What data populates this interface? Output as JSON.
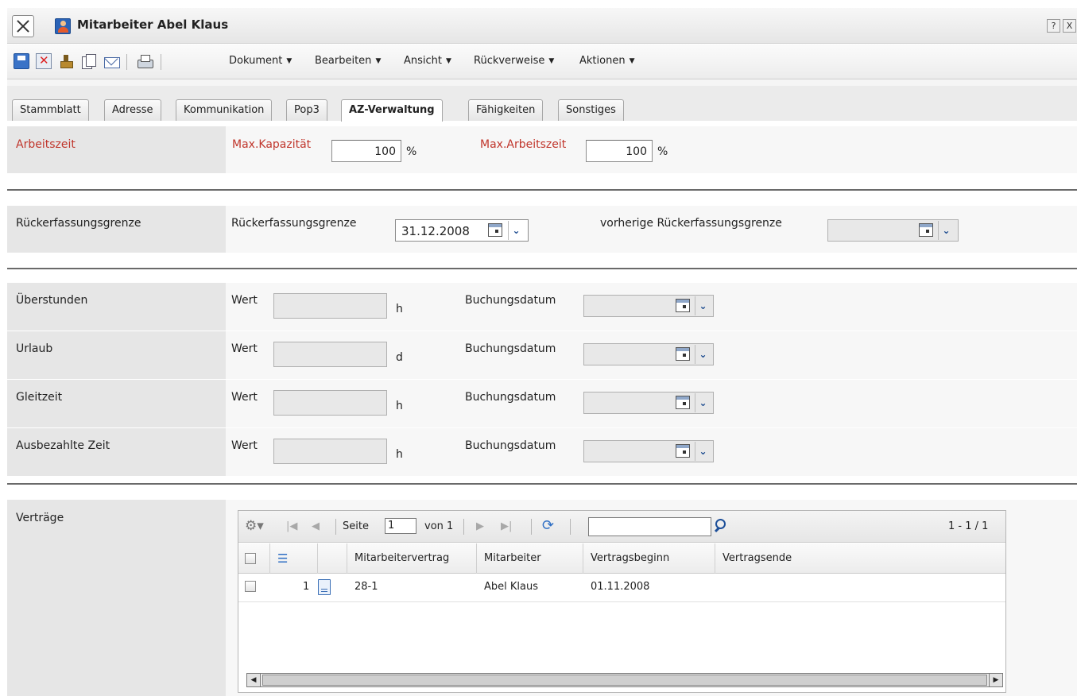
{
  "window": {
    "title": "Mitarbeiter Abel Klaus",
    "help_label": "?",
    "close_label": "X"
  },
  "toolbar": {
    "icons": [
      "save-icon",
      "delete-icon",
      "stamp-icon",
      "copy-icon",
      "mail-icon",
      "print-icon"
    ],
    "menus": [
      {
        "label": "Dokument"
      },
      {
        "label": "Bearbeiten"
      },
      {
        "label": "Ansicht"
      },
      {
        "label": "Rückverweise"
      },
      {
        "label": "Aktionen"
      }
    ],
    "menu_arrow": "▼"
  },
  "tabs": [
    {
      "label": "Stammblatt"
    },
    {
      "label": "Adresse"
    },
    {
      "label": "Kommunikation"
    },
    {
      "label": "Pop3"
    },
    {
      "label": "AZ-Verwaltung",
      "active": true
    },
    {
      "label": "Fähigkeiten"
    },
    {
      "label": "Sonstiges"
    }
  ],
  "form": {
    "arbeitszeit": {
      "section_label": "Arbeitszeit",
      "max_kapazitaet_label": "Max.Kapazität",
      "max_kapazitaet_value": "100",
      "max_kapazitaet_unit": "%",
      "max_arbeitszeit_label": "Max.Arbeitszeit",
      "max_arbeitszeit_value": "100",
      "max_arbeitszeit_unit": "%",
      "label_color": "#c0352b"
    },
    "rueckerfassung": {
      "section_label": "Rückerfassungsgrenze",
      "field_label": "Rückerfassungsgrenze",
      "field_value": "31.12.2008",
      "prev_label": "vorherige Rückerfassungsgrenze",
      "prev_value": ""
    },
    "bookings": [
      {
        "section_label": "Überstunden",
        "wert_label": "Wert",
        "wert_value": "",
        "unit": "h",
        "datum_label": "Buchungsdatum",
        "datum_value": ""
      },
      {
        "section_label": "Urlaub",
        "wert_label": "Wert",
        "wert_value": "",
        "unit": "d",
        "datum_label": "Buchungsdatum",
        "datum_value": ""
      },
      {
        "section_label": "Gleitzeit",
        "wert_label": "Wert",
        "wert_value": "",
        "unit": "h",
        "datum_label": "Buchungsdatum",
        "datum_value": ""
      },
      {
        "section_label": "Ausbezahlte Zeit",
        "wert_label": "Wert",
        "wert_value": "",
        "unit": "h",
        "datum_label": "Buchungsdatum",
        "datum_value": ""
      }
    ],
    "vertraege": {
      "section_label": "Verträge"
    }
  },
  "grid": {
    "pager": {
      "page_label": "Seite",
      "page_value": "1",
      "of_label": "von 1",
      "range_text": "1 - 1 / 1",
      "search_value": ""
    },
    "columns": [
      "Mitarbeitervertrag",
      "Mitarbeiter",
      "Vertragsbeginn",
      "Vertragsende"
    ],
    "rows": [
      {
        "num": "1",
        "vertrag": "28-1",
        "mitarbeiter": "Abel Klaus",
        "beginn": "01.11.2008",
        "ende": ""
      }
    ]
  }
}
